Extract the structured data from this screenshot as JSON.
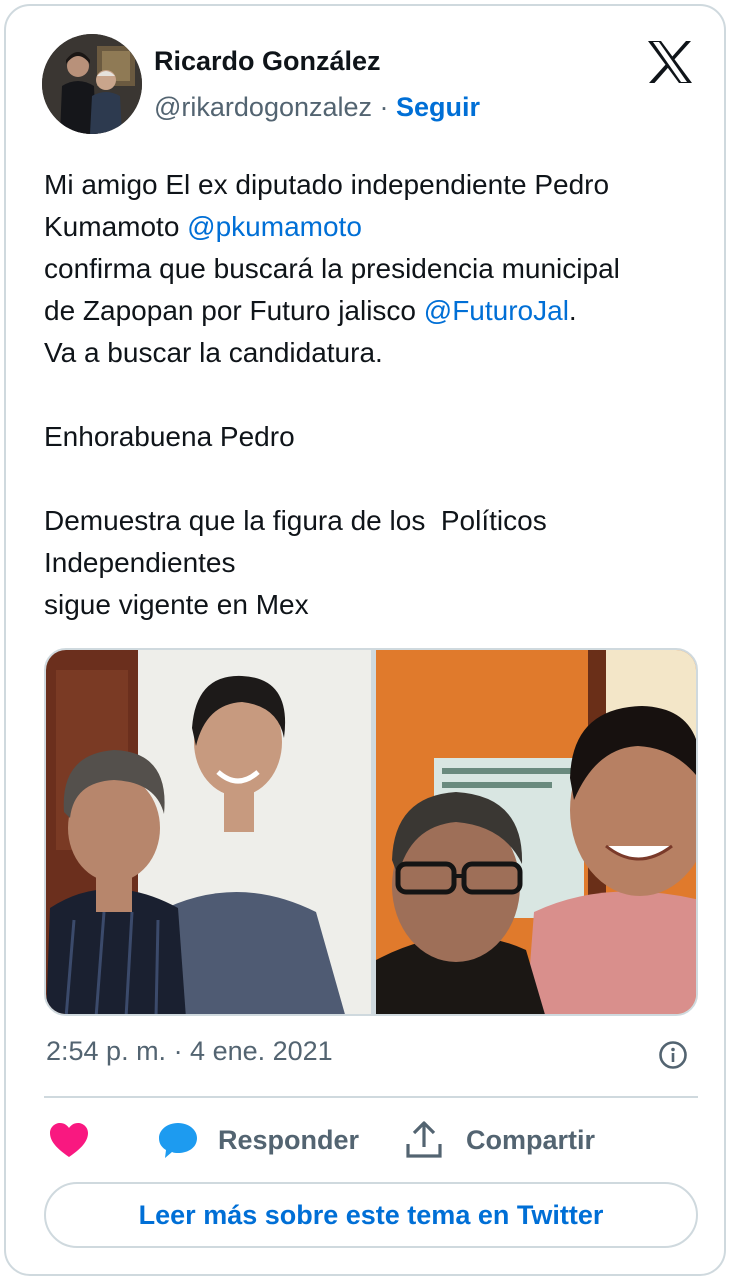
{
  "author": {
    "display_name": "Ricardo González",
    "handle": "@rikardogonzalez",
    "separator": " · ",
    "follow_label": "Seguir",
    "avatar_icon": "profile-photo-two-men"
  },
  "tweet": {
    "lines": [
      {
        "parts": [
          {
            "text": "Mi amigo El ex diputado independiente Pedro"
          }
        ]
      },
      {
        "parts": [
          {
            "text": "Kumamoto "
          },
          {
            "text": "@pkumamoto",
            "mention": true
          }
        ]
      },
      {
        "parts": [
          {
            "text": "confirma que buscará la presidencia municipal"
          }
        ]
      },
      {
        "parts": [
          {
            "text": "de Zapopan por Futuro jalisco "
          },
          {
            "text": "@FuturoJal",
            "mention": true
          },
          {
            "text": "."
          }
        ]
      },
      {
        "parts": [
          {
            "text": "Va a buscar la candidatura."
          }
        ]
      },
      {
        "parts": [
          {
            "text": ""
          }
        ]
      },
      {
        "parts": [
          {
            "text": "Enhorabuena Pedro"
          }
        ]
      },
      {
        "parts": [
          {
            "text": ""
          }
        ]
      },
      {
        "parts": [
          {
            "text": "Demuestra que la figura de los  Políticos"
          }
        ]
      },
      {
        "parts": [
          {
            "text": "Independientes"
          }
        ]
      },
      {
        "parts": [
          {
            "text": "sigue vigente en Mex"
          }
        ]
      }
    ]
  },
  "media": {
    "photos": [
      {
        "icon": "photo-two-men-standing"
      },
      {
        "icon": "photo-selfie-two-men"
      }
    ]
  },
  "timestamp": "2:54 p. m. · 4 ene. 2021",
  "actions": {
    "reply_label": "Responder",
    "share_label": "Compartir"
  },
  "read_more_label": "Leer más sobre este tema en Twitter",
  "colors": {
    "link": "#006fd6",
    "muted": "#536471",
    "text": "#0f1419",
    "like": "#f91880",
    "reply_bubble": "#1d9bf0",
    "border": "#cfd9de"
  }
}
